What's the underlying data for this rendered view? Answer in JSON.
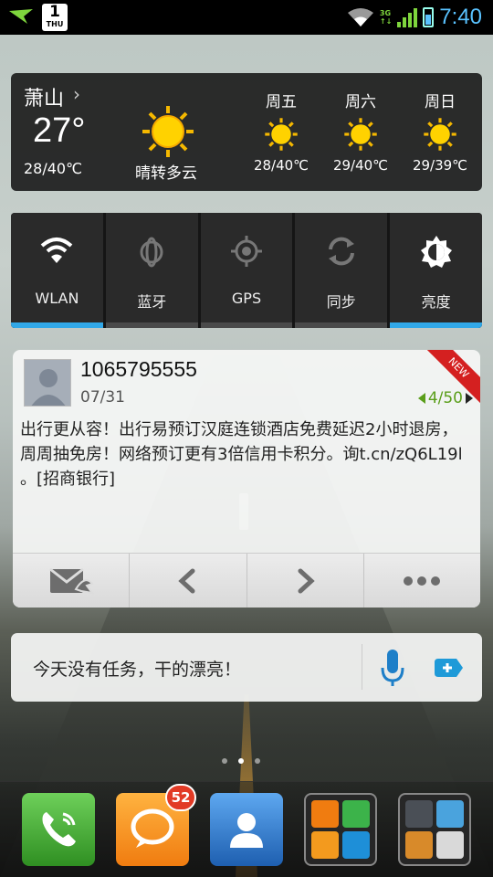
{
  "status_bar": {
    "calendar_day": "1",
    "calendar_weekday": "THU",
    "network": "3G",
    "time": "7:40"
  },
  "weather": {
    "city": "萧山",
    "current_temp": "27°",
    "current_range": "28/40℃",
    "condition": "晴转多云",
    "forecast": [
      {
        "day": "周五",
        "range": "28/40℃",
        "icon": "sun-icon"
      },
      {
        "day": "周六",
        "range": "29/40℃",
        "icon": "sun-icon"
      },
      {
        "day": "周日",
        "range": "29/39℃",
        "icon": "sun-icon"
      }
    ]
  },
  "toggles": [
    {
      "label": "WLAN",
      "icon": "wifi-icon",
      "on": true
    },
    {
      "label": "蓝牙",
      "icon": "bluetooth-icon",
      "on": false
    },
    {
      "label": "GPS",
      "icon": "gps-icon",
      "on": false
    },
    {
      "label": "同步",
      "icon": "sync-icon",
      "on": false
    },
    {
      "label": "亮度",
      "icon": "brightness-icon",
      "on": true
    }
  ],
  "sms": {
    "sender": "1065795555",
    "date": "07/31",
    "badge": "NEW",
    "counter": "4/50",
    "body": "出行更从容！出行易预订汉庭连锁酒店免费延迟2小时退房，周周抽免房！网络预订更有3倍信用卡积分。询t.cn/zQ6L19l 。[招商银行]"
  },
  "search": {
    "text": "今天没有任务，干的漂亮！"
  },
  "dock": {
    "messages_badge": "52"
  },
  "colors": {
    "accent_blue": "#31a8e8",
    "counter_green": "#5a9e1a",
    "time_blue": "#59c2ff"
  }
}
